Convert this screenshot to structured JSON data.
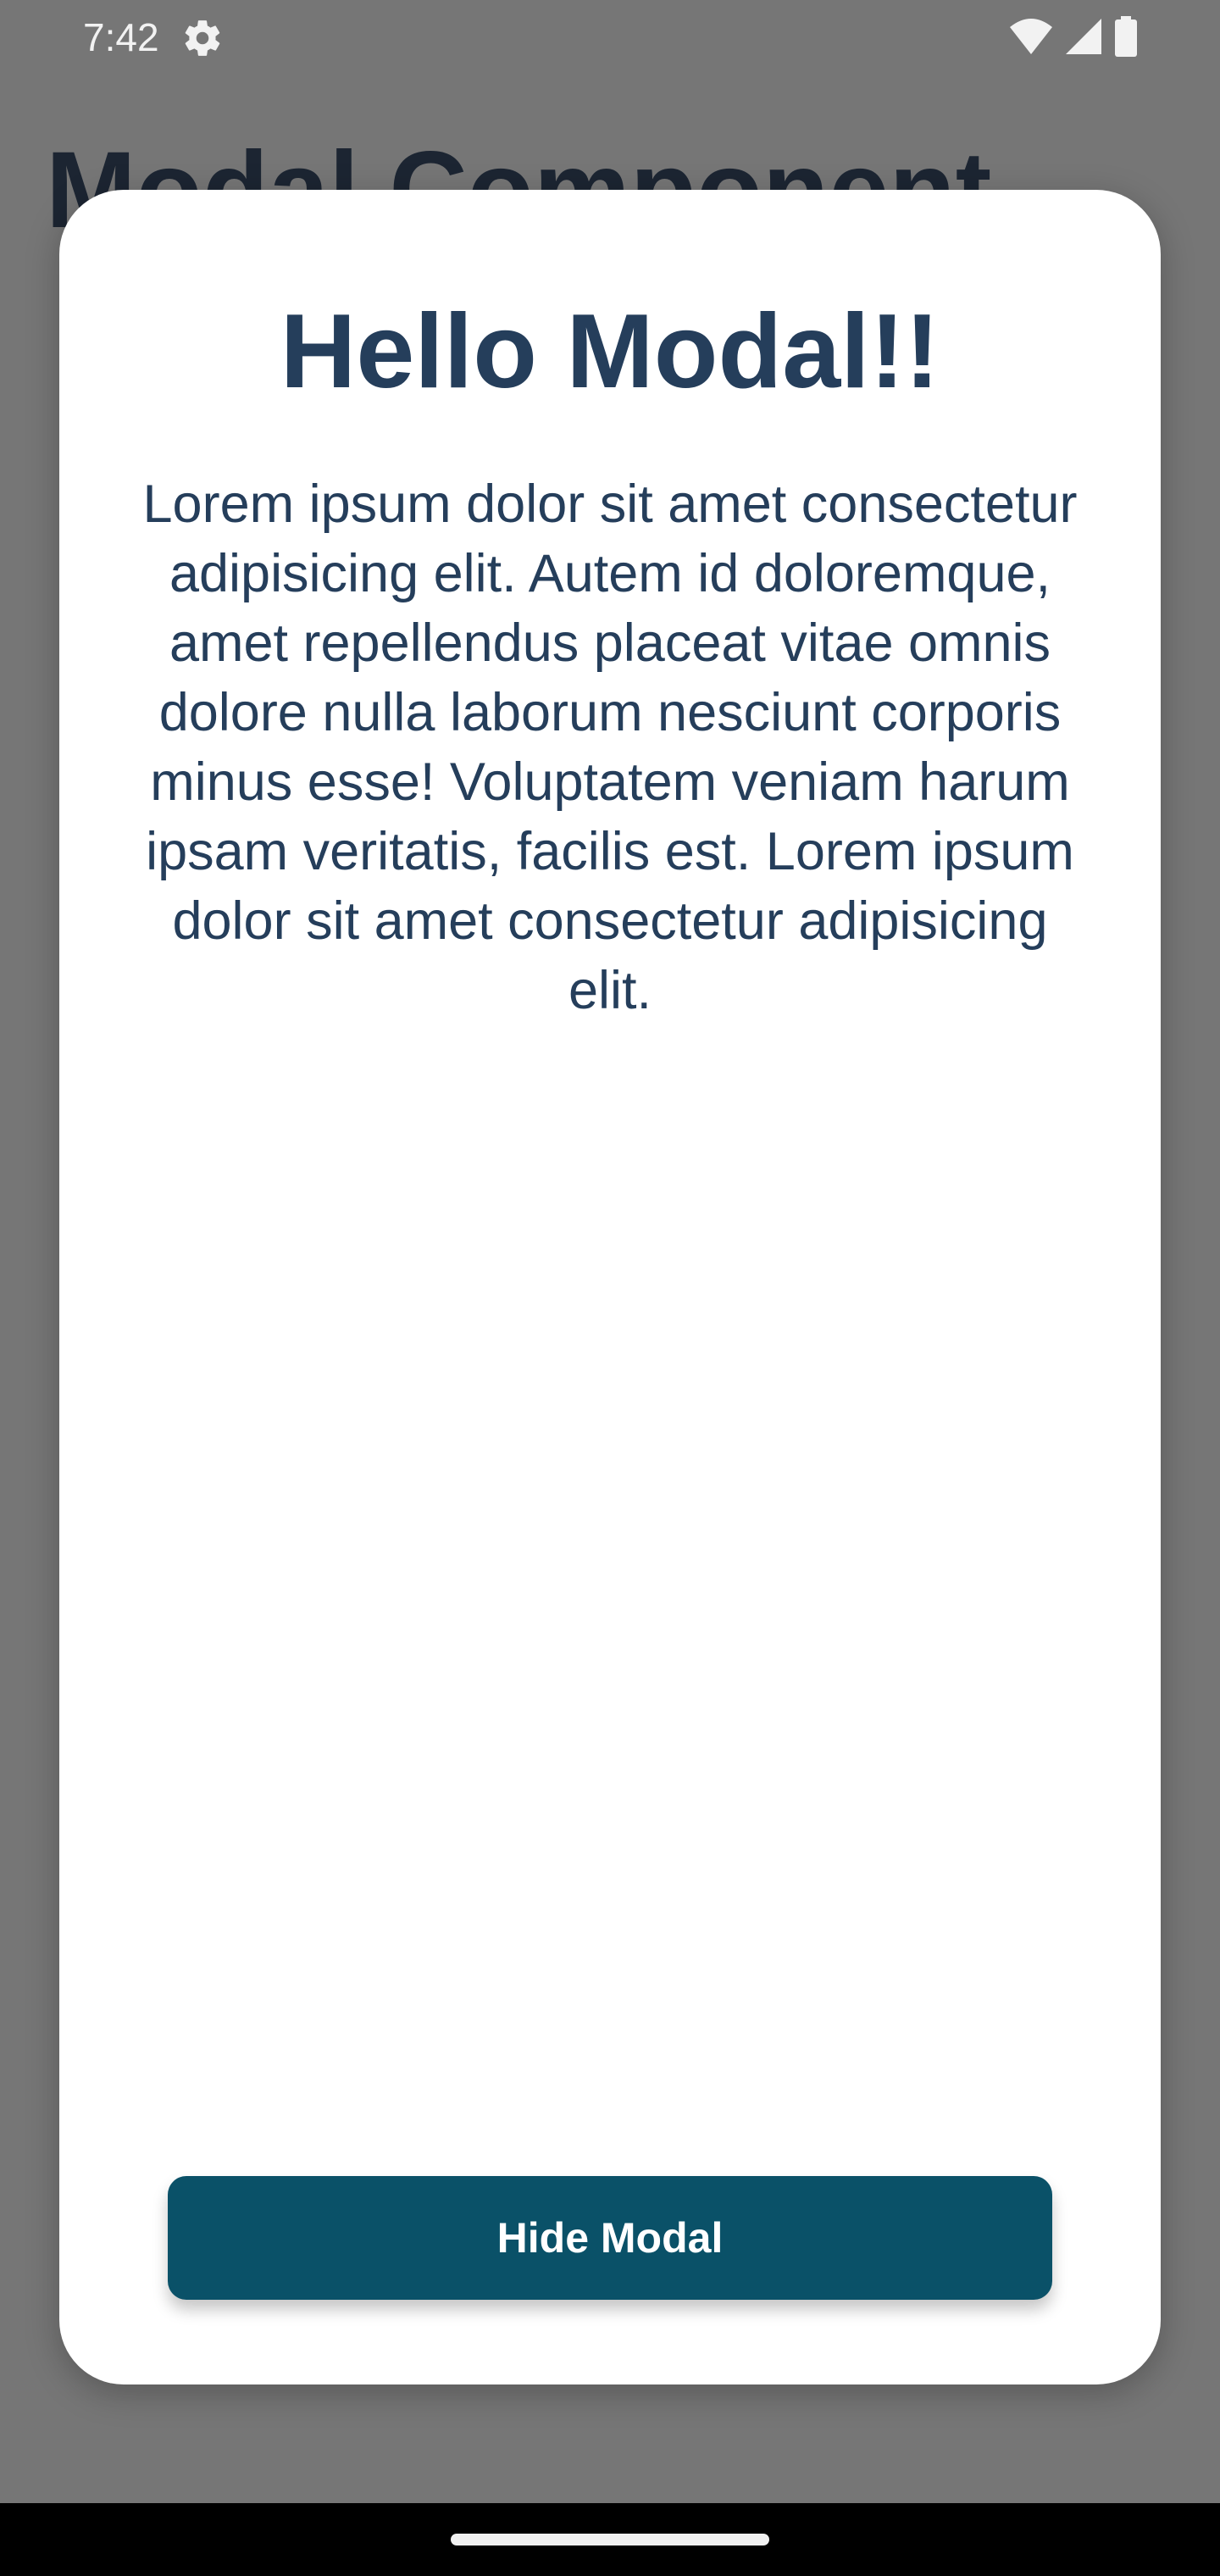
{
  "status_bar": {
    "time": "7:42",
    "icons": [
      "settings-gear-icon",
      "wifi-icon",
      "cellular-signal-icon",
      "battery-icon"
    ]
  },
  "background_page": {
    "title": "Modal Component"
  },
  "modal": {
    "title": "Hello Modal!!",
    "body": "Lorem ipsum dolor sit amet consectetur adipisicing elit. Autem id doloremque, amet repellendus placeat vitae omnis dolore nulla laborum nesciunt corporis minus esse! Voluptatem veniam harum ipsam veritatis, facilis est. Lorem ipsum dolor sit amet consectetur adipisicing elit.",
    "hide_button_label": "Hide Modal"
  },
  "colors": {
    "backdrop": "#767676",
    "title_text": "#253e5b",
    "button_bg": "#0a5168",
    "button_text": "#ffffff"
  }
}
